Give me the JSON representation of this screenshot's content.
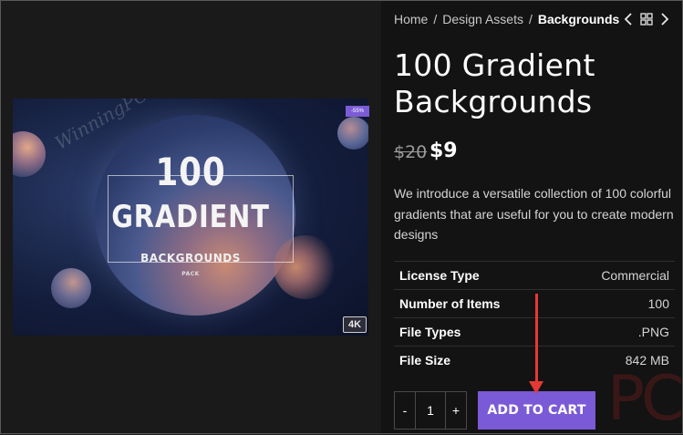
{
  "breadcrumb": {
    "items": [
      "Home",
      "Design Assets"
    ],
    "separator": "/",
    "current": "Backgrounds"
  },
  "nav": {
    "prev_icon": "chevron-left-icon",
    "grid_icon": "grid-icon",
    "next_icon": "chevron-right-icon"
  },
  "product": {
    "title": "100 Gradient Backgrounds",
    "price_old": "$20",
    "price_new": "$9",
    "description": "We introduce a versatile collection of 100 colorful gradients that are useful for you to create modern designs"
  },
  "image": {
    "line1": "100",
    "line2": "GRADIENT",
    "line3": "BACKGROUNDS",
    "line4": "PACK",
    "watermark": "WinningPC",
    "sale_badge": "-55%",
    "resolution_badge": "4K"
  },
  "specs": [
    {
      "key": "License Type",
      "value": "Commercial"
    },
    {
      "key": "Number of Items",
      "value": "100"
    },
    {
      "key": "File Types",
      "value": ".PNG"
    },
    {
      "key": "File Size",
      "value": "842 MB"
    }
  ],
  "cart": {
    "minus": "-",
    "quantity": "1",
    "plus": "+",
    "add_label": "ADD TO CART"
  },
  "overlay": {
    "watermark_right": "PC"
  },
  "colors": {
    "accent": "#7a5ad6",
    "annotation": "#e53935",
    "background": "#131313"
  }
}
